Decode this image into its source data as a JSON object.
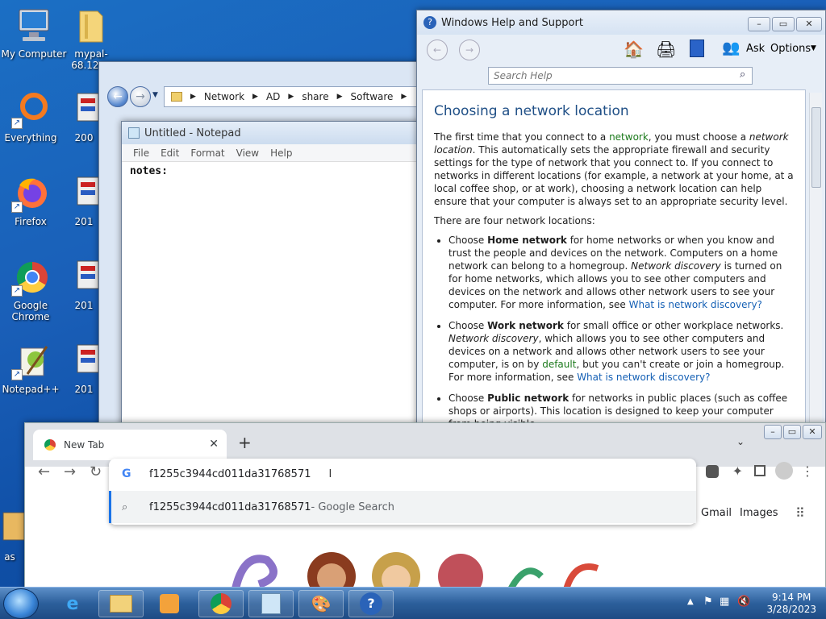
{
  "desktop": {
    "icons": [
      {
        "label": "My Computer",
        "icon": "computer-icon"
      },
      {
        "label": "mypal-68.12....",
        "icon": "folder-icon"
      },
      {
        "label": "Everything",
        "icon": "everything-icon"
      },
      {
        "label": "200",
        "icon": "installer-icon"
      },
      {
        "label": "Firefox",
        "icon": "firefox-icon"
      },
      {
        "label": "201",
        "icon": "installer-icon"
      },
      {
        "label": "Google Chrome",
        "icon": "chrome-icon"
      },
      {
        "label": "201",
        "icon": "installer-icon"
      },
      {
        "label": "Notepad++",
        "icon": "notepadpp-icon"
      },
      {
        "label": "201",
        "icon": "installer-icon"
      },
      {
        "label": "as",
        "icon": "installer-icon"
      }
    ]
  },
  "explorer": {
    "breadcrumb": [
      "Network",
      "AD",
      "share",
      "Software"
    ]
  },
  "notepad": {
    "title": "Untitled - Notepad",
    "menu": [
      "File",
      "Edit",
      "Format",
      "View",
      "Help"
    ],
    "text": "notes:"
  },
  "help": {
    "title": "Windows Help and Support",
    "toolbar": {
      "ask": "Ask",
      "options": "Options"
    },
    "search_placeholder": "Search Help",
    "heading": "Choosing a network location",
    "intro_1": "The first time that you connect to a ",
    "intro_link": "network",
    "intro_2": ", you must choose a ",
    "intro_em": "network location",
    "intro_3": ". This automatically sets the appropriate firewall and security settings for the type of network that you connect to. If you connect to networks in different locations (for example, a network at your home, at a local coffee shop, or at work), choosing a network location can help ensure that your computer is always set to an appropriate security level.",
    "four": "There are four network locations:",
    "home": {
      "a": "Choose ",
      "b": "Home network",
      "c": " for home networks or when you know and trust the people and devices on the network. Computers on a home network can belong to a homegroup. ",
      "d": "Network discovery",
      "e": " is turned on for home networks, which allows you to see other computers and devices on the network and allows other network users to see your computer. For more information, see ",
      "link": "What is network discovery?"
    },
    "work": {
      "a": "Choose ",
      "b": "Work network",
      "c": " for small office or other workplace networks. ",
      "d": "Network discovery",
      "e": ", which allows you to see other computers and devices on a network and allows other network users to see your computer, is on by ",
      "green": "default",
      "f": ", but you can't create or join a homegroup. For more information, see ",
      "link": "What is network discovery?"
    },
    "public": {
      "a": "Choose ",
      "b": "Public network",
      "c": " for networks in public places (such as coffee shops or airports). This location is designed to keep your computer from being visible"
    }
  },
  "chrome": {
    "tab_title": "New Tab",
    "omnibox_value": "f1255c3944cd011da31768571",
    "suggestion": "f1255c3944cd011da31768571",
    "suggestion_suffix": " - Google Search",
    "links": [
      "Gmail",
      "Images"
    ]
  },
  "taskbar": {
    "time": "9:14 PM",
    "date": "3/28/2023"
  }
}
